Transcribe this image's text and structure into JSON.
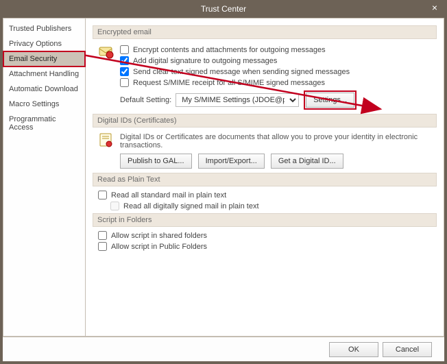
{
  "window": {
    "title": "Trust Center"
  },
  "sidebar": {
    "items": [
      {
        "label": "Trusted Publishers"
      },
      {
        "label": "Privacy Options"
      },
      {
        "label": "Email Security"
      },
      {
        "label": "Attachment Handling"
      },
      {
        "label": "Automatic Download"
      },
      {
        "label": "Macro Settings"
      },
      {
        "label": "Programmatic Access"
      }
    ]
  },
  "encrypted": {
    "header": "Encrypted email",
    "opt_encrypt": "Encrypt contents and attachments for outgoing messages",
    "opt_sign": "Add digital signature to outgoing messages",
    "opt_cleartext": "Send clear text signed message when sending signed messages",
    "opt_receipt": "Request S/MIME receipt for all S/MIME signed messages",
    "default_label": "Default Setting:",
    "default_value": "My S/MIME Settings (JDOE@pitt.edu)",
    "settings_btn": "Settings..."
  },
  "digitalids": {
    "header": "Digital IDs (Certificates)",
    "desc": "Digital IDs or Certificates are documents that allow you to prove your identity in electronic transactions.",
    "publish_btn": "Publish to GAL...",
    "import_btn": "Import/Export...",
    "getid_btn": "Get a Digital ID..."
  },
  "plaintext": {
    "header": "Read as Plain Text",
    "opt_standard": "Read all standard mail in plain text",
    "opt_signed": "Read all digitally signed mail in plain text"
  },
  "script": {
    "header": "Script in Folders",
    "opt_shared": "Allow script in shared folders",
    "opt_public": "Allow script in Public Folders"
  },
  "footer": {
    "ok": "OK",
    "cancel": "Cancel"
  }
}
